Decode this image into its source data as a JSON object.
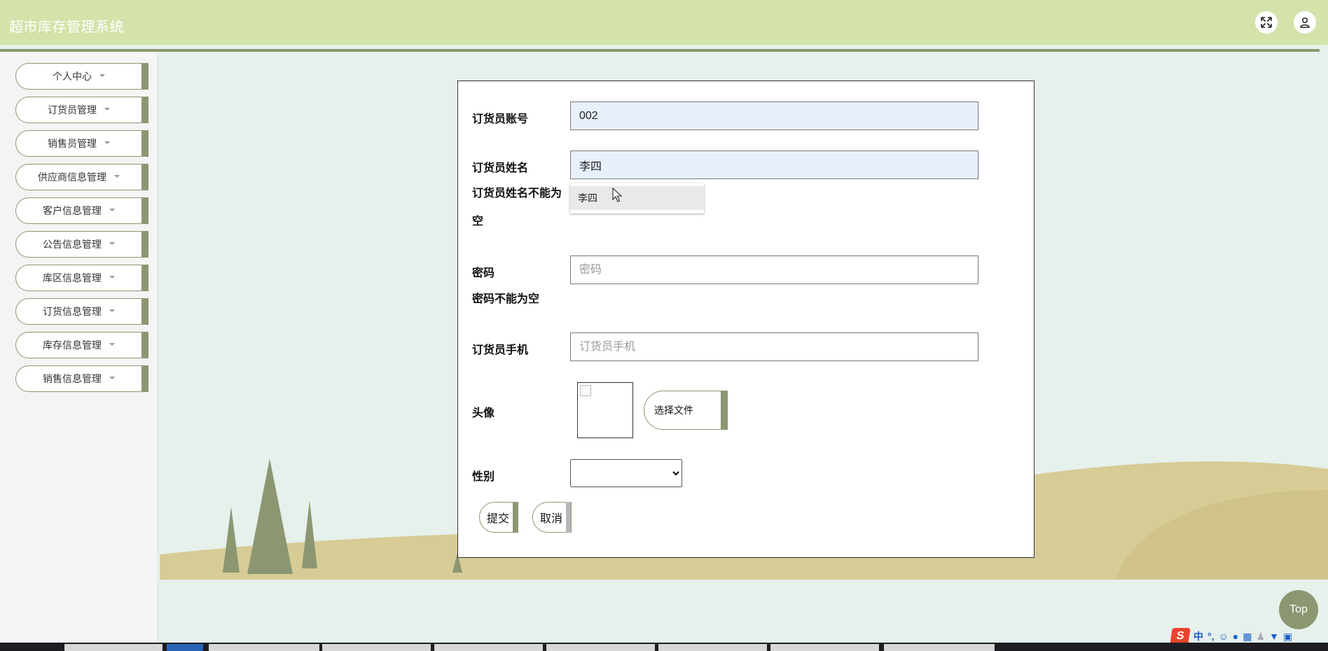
{
  "header": {
    "title": "超市库存管理系统",
    "fullscreen_icon": "expand-icon",
    "user_icon": "user-icon"
  },
  "sidebar": {
    "items": [
      {
        "label": "个人中心"
      },
      {
        "label": "订货员管理"
      },
      {
        "label": "销售员管理"
      },
      {
        "label": "供应商信息管理"
      },
      {
        "label": "客户信息管理"
      },
      {
        "label": "公告信息管理"
      },
      {
        "label": "库区信息管理"
      },
      {
        "label": "订货信息管理"
      },
      {
        "label": "库存信息管理"
      },
      {
        "label": "销售信息管理"
      }
    ]
  },
  "form": {
    "account_label": "订货员账号",
    "account_value": "002",
    "name_label": "订货员姓名",
    "name_value": "李四",
    "name_error": "订货员姓名不能为空",
    "autocomplete_suggestion": "李四",
    "password_label": "密码",
    "password_placeholder": "密码",
    "password_error": "密码不能为空",
    "phone_label": "订货员手机",
    "phone_placeholder": "订货员手机",
    "avatar_label": "头像",
    "file_button": "选择文件",
    "gender_label": "性别",
    "gender_value": "",
    "submit_button": "提交",
    "cancel_button": "取消"
  },
  "top_button": "Top",
  "ime": {
    "lang": "中",
    "punct": "°,"
  },
  "colors": {
    "header_bg": "#d4e3aa",
    "accent": "#8c9772",
    "page_bg": "#e6f1ec",
    "hill": "#d7cc95",
    "autofill": "#e8f0fe"
  }
}
